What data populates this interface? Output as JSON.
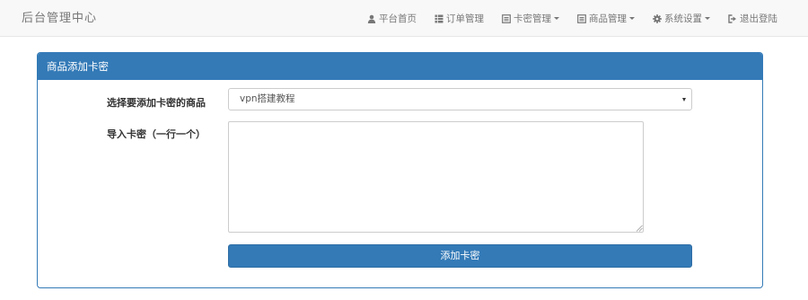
{
  "navbar": {
    "brand": "后台管理中心",
    "items": [
      {
        "label": "平台首页",
        "icon": "user-icon",
        "caret": false
      },
      {
        "label": "订单管理",
        "icon": "list-icon",
        "caret": false
      },
      {
        "label": "卡密管理",
        "icon": "list-alt-icon",
        "caret": true
      },
      {
        "label": "商品管理",
        "icon": "list-alt-icon",
        "caret": true
      },
      {
        "label": "系统设置",
        "icon": "gear-icon",
        "caret": true
      },
      {
        "label": "退出登陆",
        "icon": "logout-icon",
        "caret": false
      }
    ]
  },
  "panel": {
    "title": "商品添加卡密",
    "product_label": "选择要添加卡密的商品",
    "product_selected": "vpn搭建教程",
    "cards_label": "导入卡密（一行一个）",
    "cards_value": "",
    "submit_label": "添加卡密"
  },
  "colors": {
    "primary": "#337ab7",
    "navbar_bg": "#f8f8f8",
    "nav_text": "#777777"
  }
}
